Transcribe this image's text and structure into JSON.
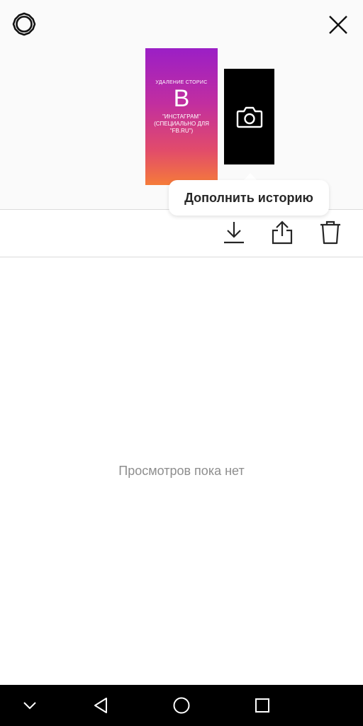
{
  "header": {
    "settings_icon": "gear-icon",
    "close_icon": "close-icon"
  },
  "story": {
    "thumb_line1": "УДАЛЕНИЕ СТОРИС",
    "thumb_big": "В",
    "thumb_line2": "\"ИНСТАГРАМ\" (СПЕЦИАЛЬНО ДЛЯ \"FB.RU\")",
    "add_icon": "camera-icon"
  },
  "tooltip": {
    "text": "Дополнить историю"
  },
  "actions": {
    "download_icon": "download-icon",
    "share_icon": "share-icon",
    "delete_icon": "trash-icon"
  },
  "viewers": {
    "empty_text": "Просмотров пока нет"
  },
  "navbar": {
    "icons": [
      "chevron-down-icon",
      "back-icon",
      "home-icon",
      "recent-apps-icon"
    ]
  }
}
